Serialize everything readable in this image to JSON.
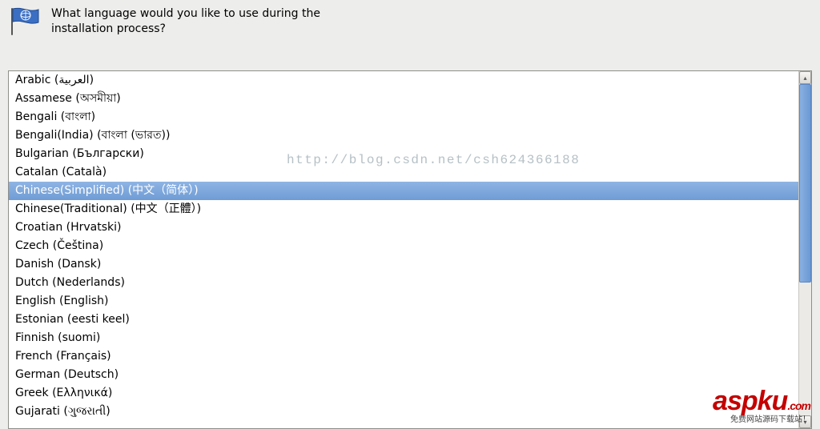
{
  "header": {
    "question": "What language would you like to use during the installation process?"
  },
  "languages": [
    {
      "label": "Arabic (العربية)",
      "selected": false
    },
    {
      "label": "Assamese (অসমীয়া)",
      "selected": false
    },
    {
      "label": "Bengali (বাংলা)",
      "selected": false
    },
    {
      "label": "Bengali(India) (বাংলা (ভারত))",
      "selected": false
    },
    {
      "label": "Bulgarian (Български)",
      "selected": false
    },
    {
      "label": "Catalan (Català)",
      "selected": false
    },
    {
      "label": "Chinese(Simplified) (中文（简体）)",
      "selected": true
    },
    {
      "label": "Chinese(Traditional) (中文（正體）)",
      "selected": false
    },
    {
      "label": "Croatian (Hrvatski)",
      "selected": false
    },
    {
      "label": "Czech (Čeština)",
      "selected": false
    },
    {
      "label": "Danish (Dansk)",
      "selected": false
    },
    {
      "label": "Dutch (Nederlands)",
      "selected": false
    },
    {
      "label": "English (English)",
      "selected": false
    },
    {
      "label": "Estonian (eesti keel)",
      "selected": false
    },
    {
      "label": "Finnish (suomi)",
      "selected": false
    },
    {
      "label": "French (Français)",
      "selected": false
    },
    {
      "label": "German (Deutsch)",
      "selected": false
    },
    {
      "label": "Greek (Ελληνικά)",
      "selected": false
    },
    {
      "label": "Gujarati (ગુજરાતી)",
      "selected": false
    }
  ],
  "watermark": {
    "url": "http://blog.csdn.net/csh624366188",
    "brand_main": "aspku",
    "brand_suffix": ".com",
    "brand_sub": "免费网站源码下载站！"
  },
  "scroll": {
    "up_glyph": "▴",
    "down_glyph": "▾"
  }
}
